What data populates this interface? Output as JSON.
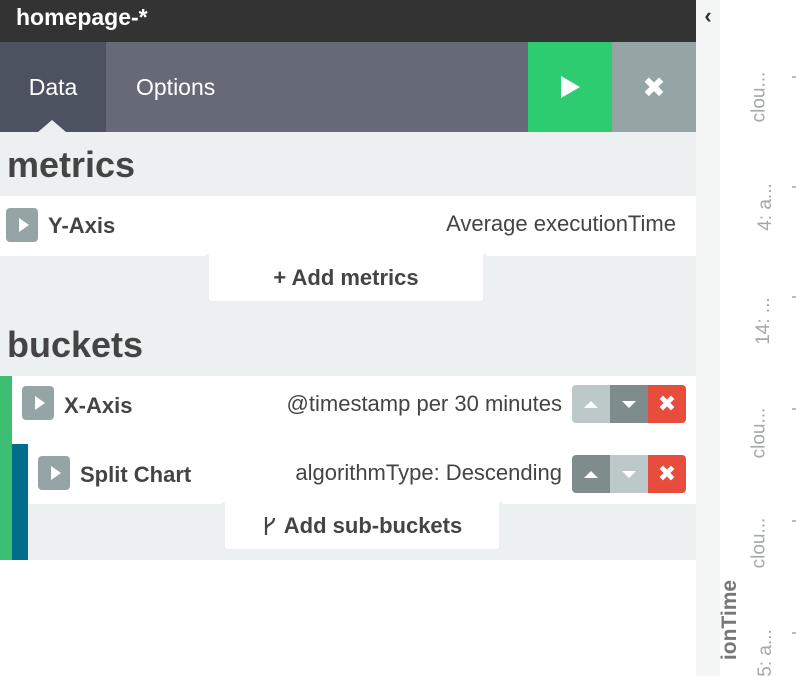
{
  "window": {
    "title": "homepage-*"
  },
  "tabs": [
    {
      "label": "Data"
    },
    {
      "label": "Options"
    }
  ],
  "actions": {
    "run_icon": "play-icon",
    "close_icon": "close-icon"
  },
  "metrics": {
    "title": "metrics",
    "items": [
      {
        "label": "Y-Axis",
        "description": "Average executionTime"
      }
    ],
    "add_label": "+ Add metrics"
  },
  "buckets": {
    "title": "buckets",
    "items": [
      {
        "label": "X-Axis",
        "description": "@timestamp per 30 minutes"
      },
      {
        "label": "Split Chart",
        "description": "algorithmType: Descending"
      }
    ],
    "add_label": "Add sub-buckets"
  },
  "chart_preview": {
    "labels": [
      "clou...",
      "4: a...",
      "14: ...",
      "clou...",
      "clou...",
      "5: a..."
    ],
    "axis_title": "ionTime"
  },
  "colors": {
    "run": "#2ecc71",
    "close": "#95a5a6",
    "delete": "#e74c3c",
    "bucket_bar_x": "#3cbf73",
    "bucket_bar_split": "#006e8a"
  }
}
